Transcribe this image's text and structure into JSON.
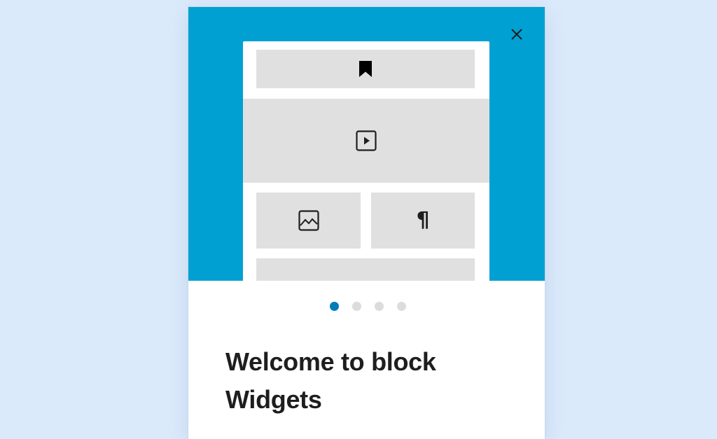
{
  "guide": {
    "close_icon": "close-icon",
    "illustration": {
      "blocks": [
        {
          "name": "top-block",
          "icon": "bookmark-icon"
        },
        {
          "name": "video-block",
          "icon": "video-icon"
        },
        {
          "name": "image-block",
          "icon": "image-icon"
        },
        {
          "name": "paragraph-block",
          "icon": "paragraph-icon",
          "glyph": "¶"
        },
        {
          "name": "bottom-block",
          "icon": ""
        }
      ]
    },
    "pagination": {
      "total": 4,
      "current": 1
    },
    "title": "Welcome to block Widgets"
  },
  "colors": {
    "hero_background": "#00a0d2",
    "page_background": "#dbeafb",
    "active_dot": "#007cba",
    "inactive_dot": "#dcdcde",
    "placeholder_block": "#e0e0e0"
  }
}
